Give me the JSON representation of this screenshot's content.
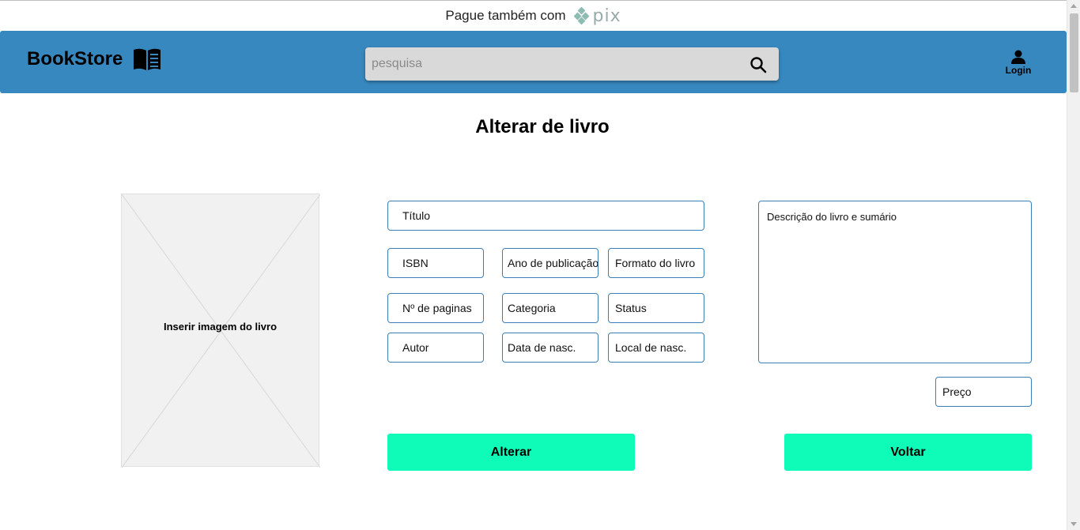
{
  "promo": {
    "text": "Pague também com",
    "logo_text": "pix"
  },
  "header": {
    "brand": "BookStore",
    "brand_icon": "open-book-icon",
    "search": {
      "placeholder": "pesquisa",
      "value": ""
    },
    "login_label": "Login"
  },
  "page_title": "Alterar de livro",
  "image_box": {
    "label": "Inserir imagem do livro"
  },
  "form": {
    "titulo": "Título",
    "isbn": "ISBN",
    "ano": "Ano de publicação",
    "formato": "Formato do livro",
    "paginas": "Nº de paginas",
    "categoria": "Categoria",
    "status": "Status",
    "autor": "Autor",
    "data_nasc": "Data de nasc.",
    "local_nasc": "Local de nasc.",
    "descricao": "Descrição do livro e sumário",
    "preco": "Preço"
  },
  "buttons": {
    "alterar": "Alterar",
    "voltar": "Voltar"
  },
  "colors": {
    "header": "#3888c0",
    "button": "#0ffcb8",
    "field_border": "#3c7fb8"
  }
}
